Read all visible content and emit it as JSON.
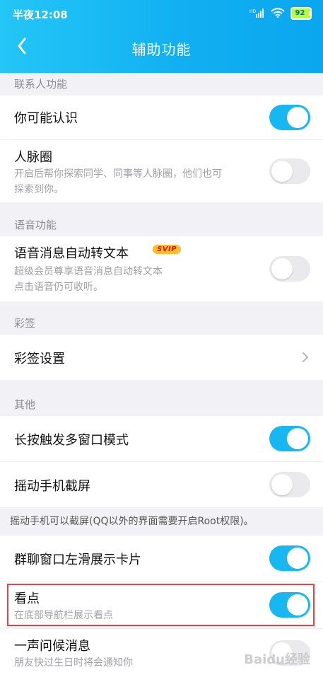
{
  "status_bar": {
    "time": "半夜12:08",
    "signal_label": "HD",
    "battery": "92"
  },
  "header": {
    "title": "辅助功能"
  },
  "sections": {
    "contacts": "联系人功能",
    "voice": "语音功能",
    "sign": "彩签",
    "other": "其他"
  },
  "rows": {
    "maybe_know": {
      "title": "你可能认识",
      "enabled": true
    },
    "network": {
      "title": "人脉圈",
      "subtitle_lines": [
        "开启后帮你探索同学、同事等人脉圈，他们也可",
        "探索到你。"
      ],
      "enabled": false
    },
    "voice_text": {
      "title": "语音消息自动转文本",
      "badge": "SVIP",
      "subtitle_lines": [
        "超级会员尊享语音消息自动转文本",
        "点击语音仍可收听。"
      ],
      "enabled": false
    },
    "sign_settings": {
      "title": "彩签设置"
    },
    "multi_window": {
      "title": "长按触发多窗口模式",
      "enabled": true
    },
    "shake_screenshot": {
      "title": "摇动手机截屏",
      "enabled": false
    },
    "group_card": {
      "title": "群聊窗口左滑展示卡片",
      "enabled": true
    },
    "kandian": {
      "title": "看点",
      "subtitle": "在底部导航栏展示看点",
      "enabled": true
    },
    "greeting": {
      "title": "一声问候消息",
      "subtitle": "朋友快过生日时将会通知你",
      "enabled": false
    }
  },
  "notes": {
    "shake_note": "摇动手机可以截屏(QQ以外的界面需要开启Root权限)。"
  },
  "watermark": "Baidu经验",
  "colors": {
    "accent": "#17b8f2",
    "toggle_off": "#e9e9ee",
    "highlight_border": "#d84a4a",
    "header_start": "#24c6f7",
    "header_end": "#0aa6ef"
  },
  "icons": {
    "back": "back-arrow-icon",
    "chevron": "chevron-right-icon",
    "wifi": "wifi-icon",
    "signal": "signal-icon",
    "battery": "battery-icon"
  }
}
